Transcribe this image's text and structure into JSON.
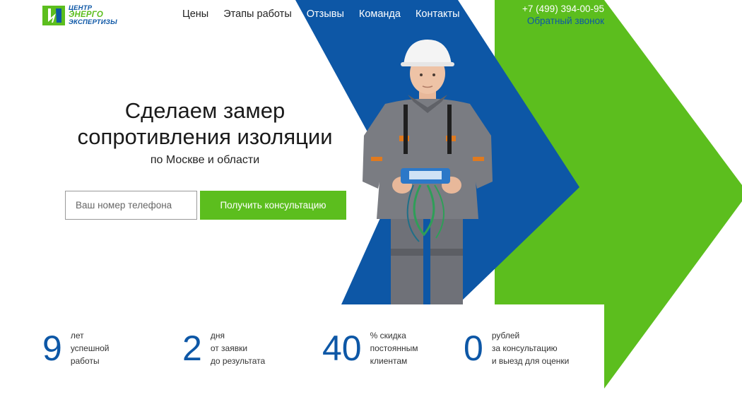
{
  "brand": {
    "line1": "ЦЕНТР",
    "line2": "ЭНЕРГО",
    "line3": "ЭКСПЕРТИЗЫ",
    "colors": {
      "blue": "#0d57a6",
      "green": "#5cbe1e"
    },
    "icon": "lightning-logo-icon"
  },
  "nav": {
    "items": [
      {
        "label": "Цены"
      },
      {
        "label": "Этапы работы"
      },
      {
        "label": "Отзывы"
      },
      {
        "label": "Команда"
      },
      {
        "label": "Контакты"
      }
    ]
  },
  "contact": {
    "phone": "+7 (499) 394-00-95",
    "callback": "Обратный звонок"
  },
  "hero": {
    "title_line1": "Сделаем замер",
    "title_line2": "сопротивления изоляции",
    "subtitle": "по Москве и области"
  },
  "form": {
    "phone_placeholder": "Ваш номер телефона",
    "phone_value": "",
    "submit_label": "Получить консультацию"
  },
  "stats": [
    {
      "number": "9",
      "lines": [
        "лет",
        "успешной",
        "работы"
      ]
    },
    {
      "number": "2",
      "lines": [
        "дня",
        "от заявки",
        "до результата"
      ]
    },
    {
      "number": "40",
      "lines": [
        "% скидка",
        "постоянным",
        "клиентам"
      ]
    },
    {
      "number": "0",
      "lines": [
        "рублей",
        "за консультацию",
        "и выезд для оценки"
      ]
    }
  ]
}
